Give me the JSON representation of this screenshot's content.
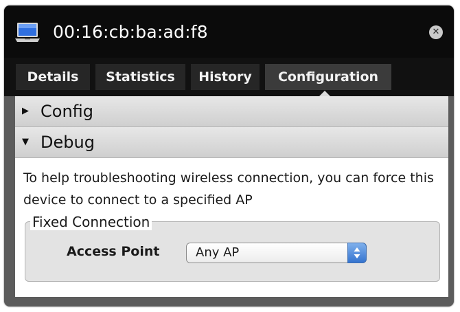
{
  "window": {
    "title": "00:16:cb:ba:ad:f8",
    "icons": {
      "device": "laptop-icon",
      "close": "close-icon"
    },
    "close_glyph": "✕"
  },
  "tabs": [
    {
      "label": "Details",
      "active": false
    },
    {
      "label": "Statistics",
      "active": false
    },
    {
      "label": "History",
      "active": false
    },
    {
      "label": "Configuration",
      "active": true
    }
  ],
  "sections": {
    "config": {
      "label": "Config",
      "expanded": false,
      "arrow": "▶"
    },
    "debug": {
      "label": "Debug",
      "expanded": true,
      "arrow": "▼"
    }
  },
  "debug": {
    "description": "To help troubleshooting wireless connection, you can force this device to connect to a specified AP",
    "group_title": "Fixed Connection",
    "field_label": "Access Point",
    "access_point": {
      "value": "Any AP"
    }
  },
  "colors": {
    "accent": "#3574d0",
    "titlebar": "#0b0b0b"
  }
}
